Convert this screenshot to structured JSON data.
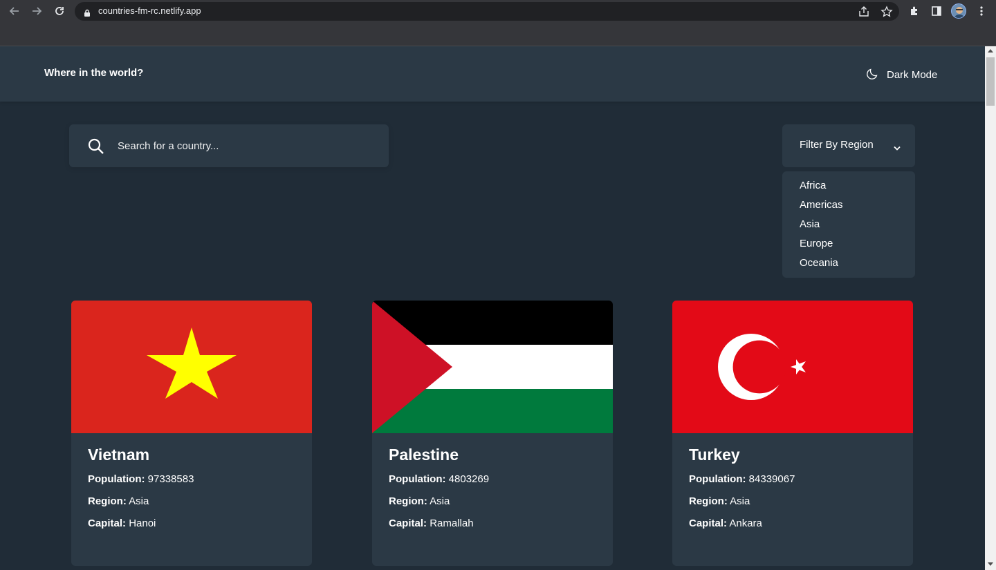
{
  "browser": {
    "url": "countries-fm-rc.netlify.app",
    "icons": [
      "back-icon",
      "forward-icon",
      "reload-icon",
      "lock-icon",
      "share-icon",
      "star-icon",
      "extensions-icon",
      "sidebar-icon",
      "avatar",
      "menu-icon"
    ]
  },
  "header": {
    "title": "Where in the world?",
    "theme_toggle": "Dark Mode",
    "theme_icon": "moon-icon"
  },
  "search": {
    "placeholder": "Search for a country...",
    "icon": "search-icon"
  },
  "filter": {
    "label": "Filter By Region",
    "icon": "chevron-down-icon",
    "options": [
      "Africa",
      "Americas",
      "Asia",
      "Europe",
      "Oceania"
    ]
  },
  "countries": [
    {
      "name": "Vietnam",
      "population_label": "Population:",
      "population": "97338583",
      "region_label": "Region:",
      "region": "Asia",
      "capital_label": "Capital:",
      "capital": "Hanoi",
      "flag": "vietnam-flag"
    },
    {
      "name": "Palestine",
      "population_label": "Population:",
      "population": "4803269",
      "region_label": "Region:",
      "region": "Asia",
      "capital_label": "Capital:",
      "capital": "Ramallah",
      "flag": "palestine-flag"
    },
    {
      "name": "Turkey",
      "population_label": "Population:",
      "population": "84339067",
      "region_label": "Region:",
      "region": "Asia",
      "capital_label": "Capital:",
      "capital": "Ankara",
      "flag": "turkey-flag"
    }
  ],
  "colors": {
    "background": "#202c37",
    "element": "#2b3945",
    "text": "#ffffff"
  }
}
